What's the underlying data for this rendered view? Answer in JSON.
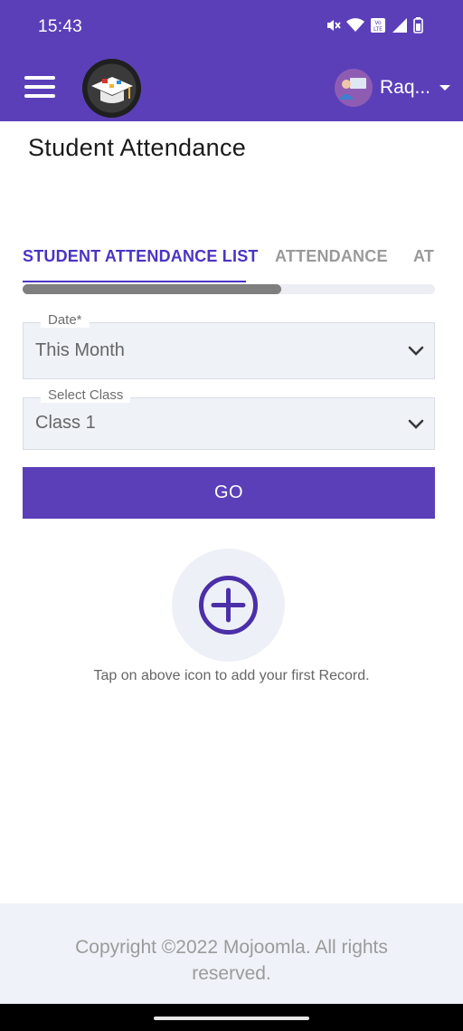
{
  "status_bar": {
    "time": "15:43",
    "icons": [
      "mute-icon",
      "wifi-icon",
      "volte-icon",
      "signal-icon",
      "battery-icon"
    ]
  },
  "app_bar": {
    "menu_icon": "hamburger-menu-icon",
    "user_name": "Raq...",
    "colors": {
      "primary": "#5b3fb9"
    }
  },
  "page": {
    "title": "Student Attendance"
  },
  "tabs": [
    {
      "label": "STUDENT ATTENDANCE LIST",
      "active": true
    },
    {
      "label": "ATTENDANCE",
      "active": false
    },
    {
      "label": "AT",
      "active": false
    }
  ],
  "form": {
    "date": {
      "label": "Date*",
      "value": "This Month"
    },
    "class": {
      "label": "Select Class",
      "value": "Class 1"
    },
    "go_label": "GO"
  },
  "empty_state": {
    "icon": "add-circle-icon",
    "message": "Tap on above icon to add your first Record."
  },
  "footer": {
    "copyright": "Copyright ©2022 Mojoomla. All rights reserved."
  }
}
